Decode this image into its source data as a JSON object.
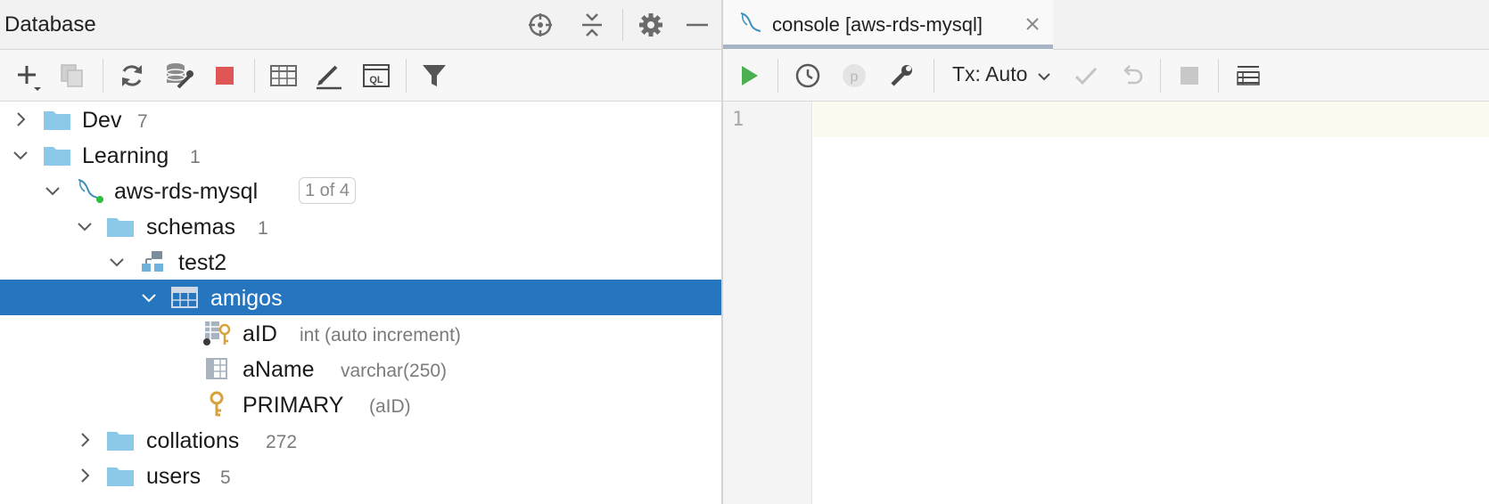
{
  "left_panel": {
    "title": "Database",
    "header_icons": [
      "crosshair-icon",
      "collapse-all-icon",
      "gear-icon",
      "minimize-icon"
    ],
    "toolbar_icons": [
      "add-icon",
      "duplicate-icon",
      "refresh-icon",
      "datasource-properties-icon",
      "stop-icon",
      "table-view-icon",
      "edit-icon",
      "jump-to-console-icon",
      "filter-icon"
    ]
  },
  "tree": {
    "items": [
      {
        "label": "Dev",
        "count": "7",
        "icon": "folder-icon",
        "expanded": false
      },
      {
        "label": "Learning",
        "count": "1",
        "icon": "folder-icon",
        "expanded": true
      },
      {
        "label": "aws-rds-mysql",
        "badge": "1 of 4",
        "icon": "mysql-icon",
        "expanded": true
      },
      {
        "label": "schemas",
        "count": "1",
        "icon": "folder-icon",
        "expanded": true
      },
      {
        "label": "test2",
        "icon": "schema-icon",
        "expanded": true
      },
      {
        "label": "amigos",
        "icon": "table-icon",
        "expanded": true,
        "selected": true
      },
      {
        "label": "aID",
        "type": "int (auto increment)",
        "icon": "primary-key-column-icon"
      },
      {
        "label": "aName",
        "type": "varchar(250)",
        "icon": "column-icon"
      },
      {
        "label": "PRIMARY",
        "type": "(aID)",
        "icon": "key-icon"
      },
      {
        "label": "collations",
        "count": "272",
        "icon": "folder-icon",
        "expanded": false
      },
      {
        "label": "users",
        "count": "5",
        "icon": "folder-icon",
        "expanded": false
      }
    ]
  },
  "right_panel": {
    "tab": {
      "label": "console [aws-rds-mysql]",
      "icon": "mysql-icon"
    },
    "toolbar_icons": [
      "run-icon",
      "history-icon",
      "parameters-icon",
      "settings-wrench-icon",
      "commit-icon",
      "rollback-icon",
      "stop-icon",
      "output-table-icon"
    ],
    "tx_mode": "Tx: Auto",
    "editor": {
      "line_number": "1"
    }
  },
  "colors": {
    "selection": "#2675bf",
    "folder": "#8cc8e8",
    "run_green": "#4caf50",
    "stop_red": "#e05555",
    "key_gold": "#d9a13b"
  }
}
